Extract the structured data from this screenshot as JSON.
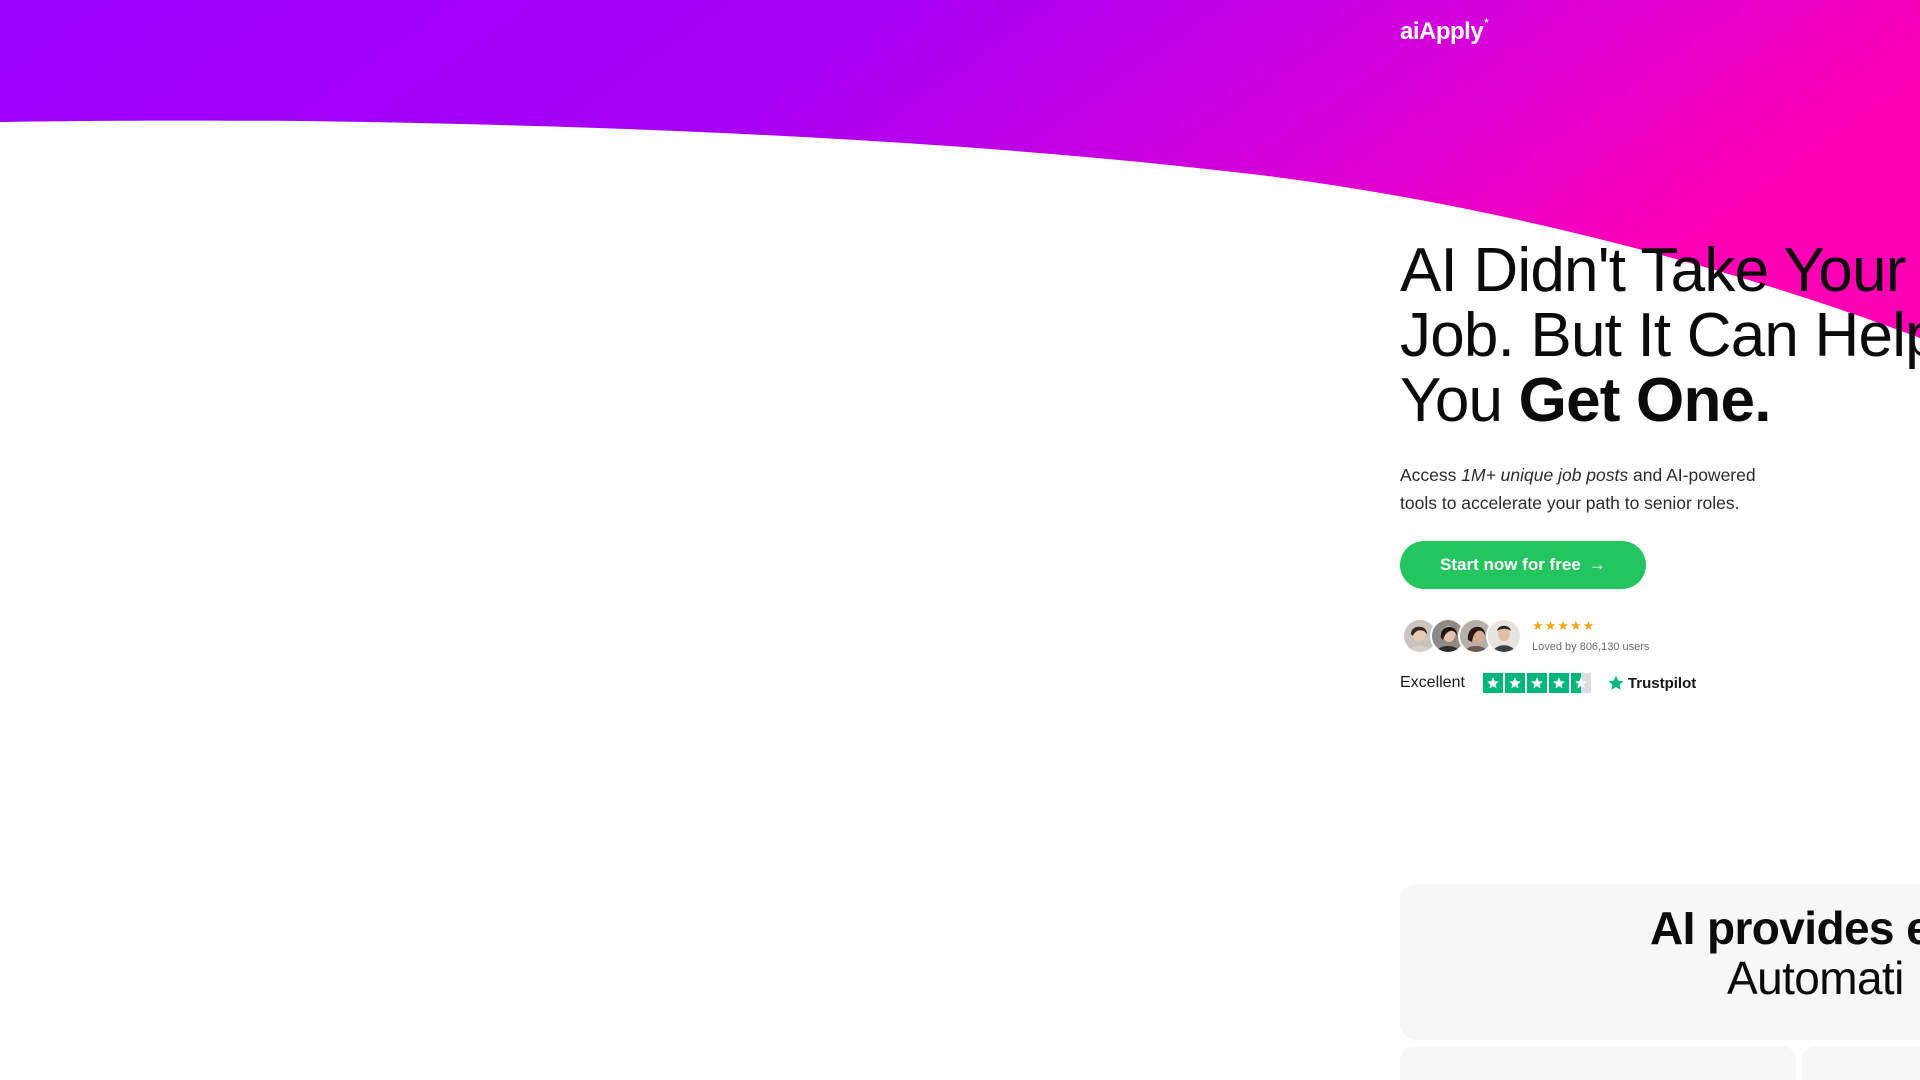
{
  "brand": {
    "logo_text": "aiApply",
    "logo_spark": "*"
  },
  "hero": {
    "headline_line1": "AI Didn't Take Your",
    "headline_line2": "Job. But It Can Help",
    "headline_line3_normal": "You ",
    "headline_line3_bold": "Get One.",
    "subtext_before": "Access ",
    "subtext_italic": "1M+ unique job posts",
    "subtext_after": " and AI-powered tools to accelerate your path to senior roles.",
    "cta_label": "Start now for free",
    "cta_arrow": "→"
  },
  "social_proof": {
    "stars": "★★★★★",
    "loved_text": "Loved by 806,130 users"
  },
  "trustpilot": {
    "rating_word": "Excellent",
    "brand": "Trustpilot",
    "stars": 4.5
  },
  "feature": {
    "title": "AI provides e",
    "subtitle": "Automati"
  },
  "colors": {
    "gradient_start": "#9900ff",
    "gradient_end": "#ff00b8",
    "cta_green": "#22c55e",
    "trustpilot_green": "#00b67a",
    "star_gold": "#f2a516"
  }
}
